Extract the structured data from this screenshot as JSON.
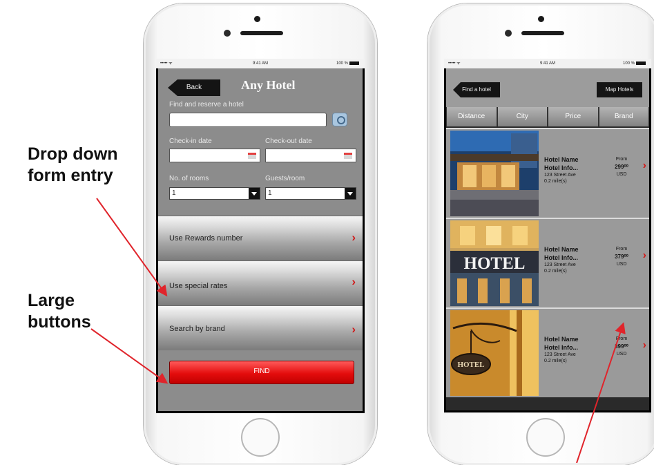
{
  "annotations": {
    "dropdown_line1": "Drop down",
    "dropdown_line2": "form entry",
    "buttons_line1": "Large",
    "buttons_line2": "buttons",
    "arrow_color": "#e0242b"
  },
  "status_bar": {
    "signal": "••••• ᯤ",
    "time": "9:41 AM",
    "battery": "100 %"
  },
  "search_screen": {
    "back_label": "Back",
    "title": "Any Hotel",
    "find_label": "Find and reserve a hotel",
    "search_value": "",
    "checkin_label": "Check-in date",
    "checkin_value": "",
    "checkout_label": "Check-out date",
    "checkout_value": "",
    "rooms_label": "No. of rooms",
    "rooms_value": "1",
    "guests_label": "Guests/room",
    "guests_value": "1",
    "options": [
      {
        "label": "Use Rewards number"
      },
      {
        "label": "Use special rates"
      },
      {
        "label": "Search by brand"
      }
    ],
    "find_button": "FIND"
  },
  "results_screen": {
    "back_label": "Find a hotel",
    "map_label": "Map Hotels",
    "tabs": [
      "Distance",
      "City",
      "Price",
      "Brand"
    ],
    "results": [
      {
        "name": "Hotel Name",
        "info": "Hotel Info...",
        "street": "123 Street Ave",
        "distance": "0.2 mile(s)",
        "from": "From",
        "price": "299⁰⁰",
        "currency": "USD"
      },
      {
        "name": "Hotel Name",
        "info": "Hotel Info...",
        "street": "123 Street Ave",
        "distance": "0.2 mile(s)",
        "from": "From",
        "price": "379⁰⁰",
        "currency": "USD"
      },
      {
        "name": "Hotel Name",
        "info": "Hotel Info...",
        "street": "123 Street Ave",
        "distance": "0.2 mile(s)",
        "from": "From",
        "price": "399⁰⁰",
        "currency": "USD"
      }
    ],
    "photo_labels": [
      "HOTEL",
      "HOTEL"
    ]
  },
  "colors": {
    "accent_red": "#e0242b",
    "find_button": "#e40d0d",
    "panel_gray": "#8c8c8c"
  },
  "icons": [
    "back-arrow-icon",
    "camera-icon",
    "calendar-icon",
    "dropdown-arrow-icon",
    "chevron-right-icon"
  ]
}
